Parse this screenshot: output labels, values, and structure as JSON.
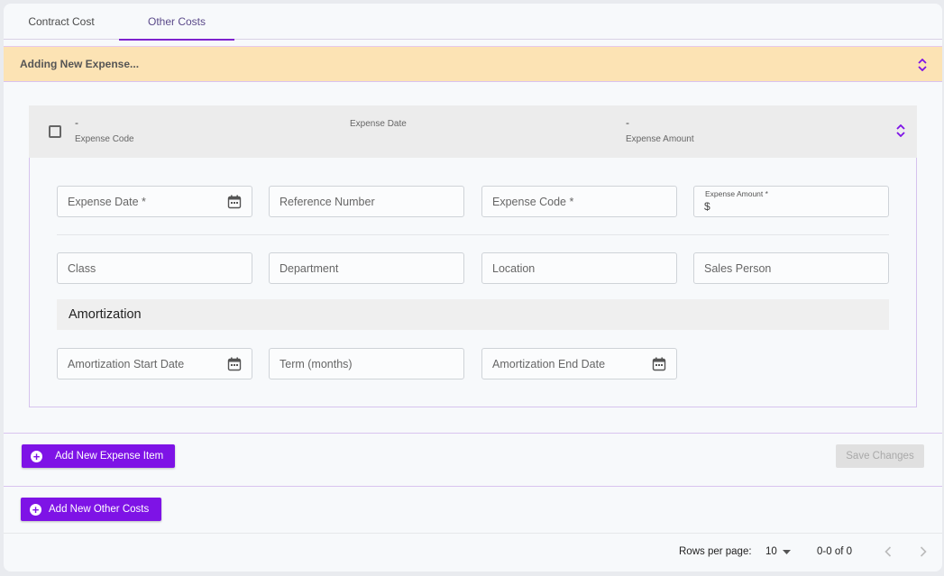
{
  "tabs": [
    {
      "label": "Contract Cost"
    },
    {
      "label": "Other Costs"
    }
  ],
  "banner": {
    "title": "Adding New Expense..."
  },
  "expense_summary": {
    "code_value": "-",
    "code_label": "Expense Code",
    "date_label": "Expense Date",
    "amount_value": "-",
    "amount_label": "Expense Amount"
  },
  "form": {
    "row1": {
      "expense_date": "Expense Date *",
      "reference_number": "Reference Number",
      "expense_code": "Expense Code *",
      "expense_amount_label": "Expense Amount *",
      "expense_amount_prefix": "$"
    },
    "row2": {
      "class": "Class",
      "department": "Department",
      "location": "Location",
      "sales_person": "Sales Person"
    },
    "amortization": {
      "heading": "Amortization",
      "start_date": "Amortization Start Date",
      "term": "Term (months)",
      "end_date": "Amortization End Date"
    }
  },
  "actions": {
    "add_expense_item": "Add New Expense Item",
    "save_changes": "Save Changes",
    "add_other_costs": "Add New Other Costs"
  },
  "pagination": {
    "rows_label": "Rows per page:",
    "rows_value": "10",
    "range": "0-0 of 0"
  },
  "colors": {
    "accent": "#7e13e6",
    "banner": "#fce3b4"
  }
}
